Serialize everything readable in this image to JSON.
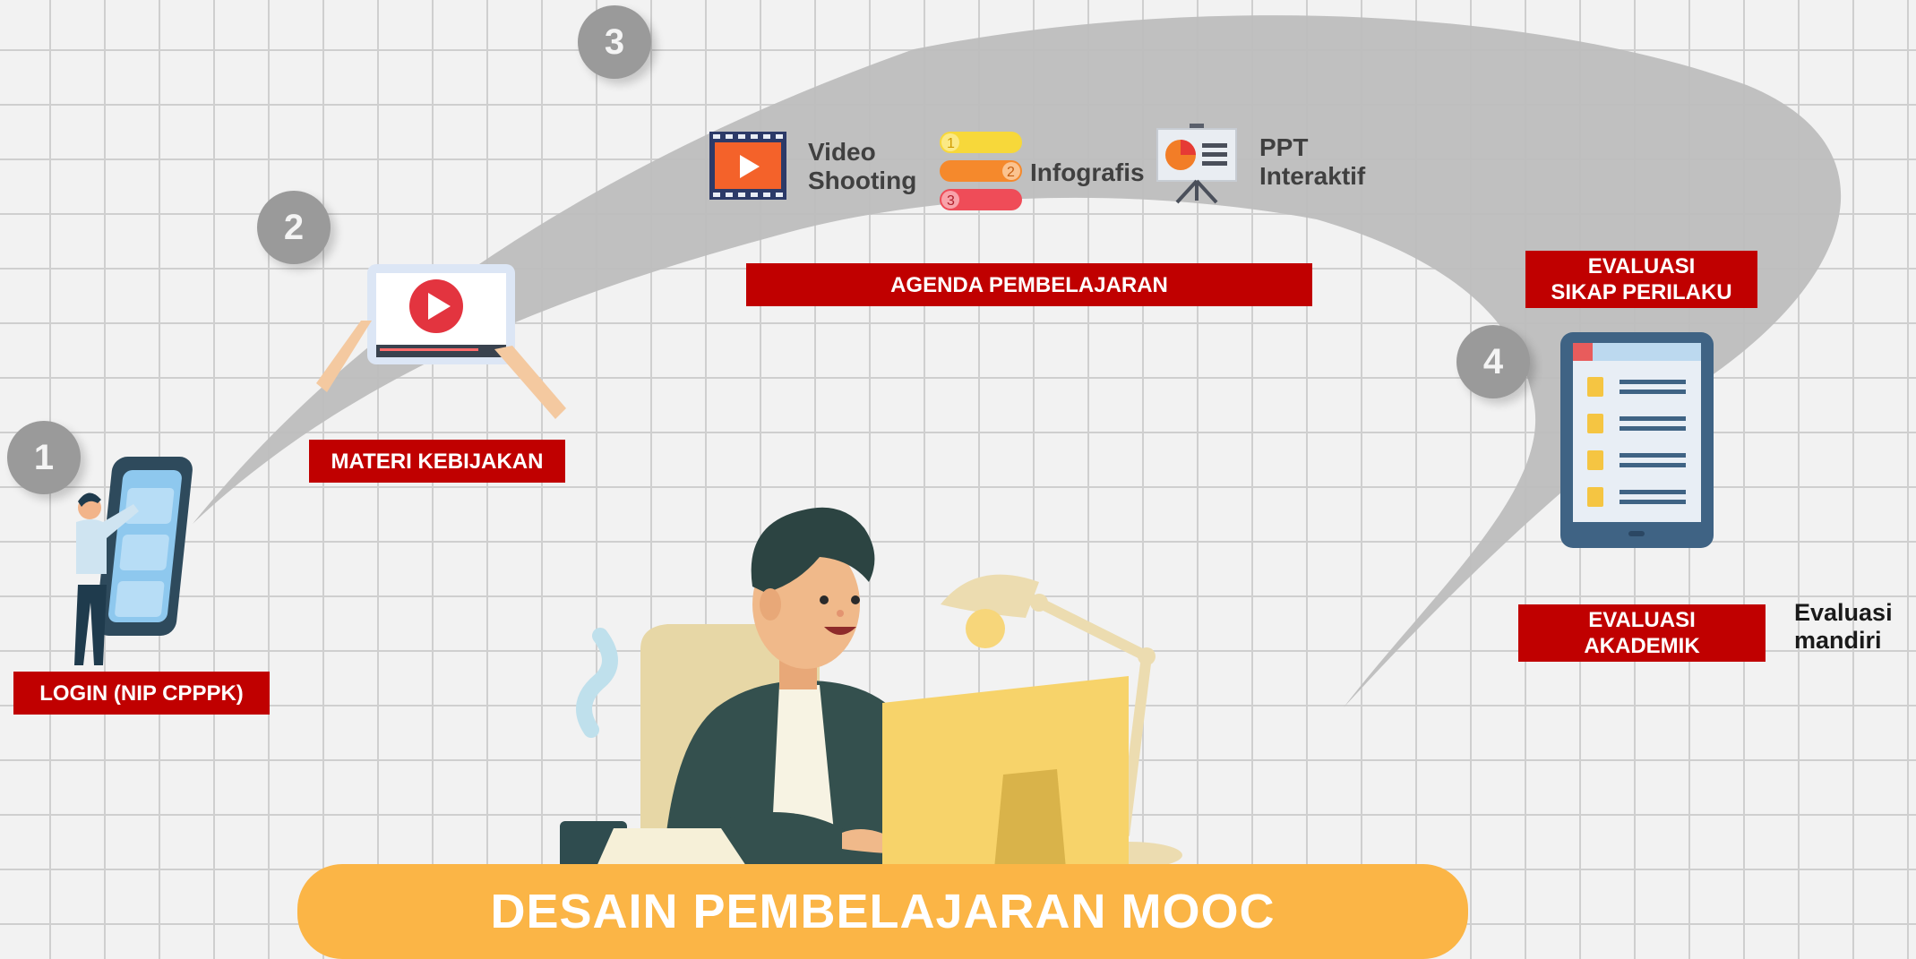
{
  "title": "DESAIN PEMBELAJARAN MOOC",
  "steps": [
    {
      "number": "1",
      "label": "LOGIN (NIP CPPPK)"
    },
    {
      "number": "2",
      "label": "MATERI KEBIJAKAN"
    },
    {
      "number": "3",
      "label": "AGENDA PEMBELAJARAN"
    },
    {
      "number": "4",
      "label_top": "EVALUASI\nSIKAP PERILAKU",
      "label_bottom": "EVALUASI\nAKADEMIK"
    }
  ],
  "media": [
    {
      "icon": "video-icon",
      "label": "Video\nShooting"
    },
    {
      "icon": "infographic-icon",
      "label": "Infografis"
    },
    {
      "icon": "presentation-icon",
      "label": "PPT\nInteraktif"
    }
  ],
  "note": "Evaluasi\nmandiri",
  "colors": {
    "accent_red": "#c00000",
    "title_bar": "#fbb546",
    "badge": "#9a9a9a",
    "flow_shape": "#bdbdbd"
  }
}
